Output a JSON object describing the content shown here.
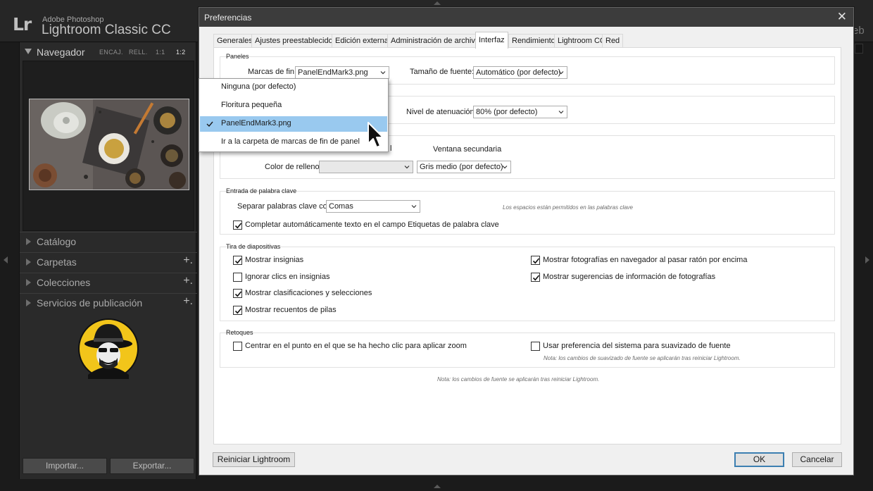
{
  "app": {
    "brand_small": "Adobe Photoshop",
    "brand_big": "Lightroom Classic CC",
    "logo": "Lr",
    "right_fragment": "eb"
  },
  "navigator": {
    "title": "Navegador",
    "zoom_options": [
      "ENCAJ.",
      "RELL.",
      "1:1",
      "1:2"
    ],
    "active_zoom": "1:2"
  },
  "panels": [
    {
      "label": "Catálogo",
      "plus": ""
    },
    {
      "label": "Carpetas",
      "plus": "+."
    },
    {
      "label": "Colecciones",
      "plus": "+."
    },
    {
      "label": "Servicios de publicación",
      "plus": "+."
    }
  ],
  "bottom_buttons": {
    "import": "Importar...",
    "export": "Exportar..."
  },
  "dialog": {
    "title": "Preferencias",
    "close": "✕",
    "tabs": [
      "Generales",
      "Ajustes preestablecidos",
      "Edición externa",
      "Administración de archivos",
      "Interfaz",
      "Rendimiento",
      "Lightroom CC",
      "Red"
    ],
    "active_tab": "Interfaz",
    "paneles": {
      "group_label": "Paneles",
      "end_marks_label": "Marcas de fin:",
      "end_marks_value": "PanelEndMark3.png",
      "font_size_label": "Tamaño de fuente:",
      "font_size_value": "Automático (por defecto)"
    },
    "lights_out": {
      "dim_level_label": "Nivel de atenuación:",
      "dim_level_value": "80% (por defecto)"
    },
    "background": {
      "fragment": "l",
      "secondary_window_label": "Ventana secundaria",
      "fill_color_label": "Color de relleno:",
      "fill_main_value": "",
      "fill_secondary_value": "Gris medio (por defecto)"
    },
    "keyword_entry": {
      "group_label": "Entrada de palabra clave",
      "separator_label": "Separar palabras clave con:",
      "separator_value": "Comas",
      "separator_note": "Los espacios están permitidos en las palabras clave",
      "autocomplete_label": "Completar automáticamente texto en el campo Etiquetas de palabra clave",
      "autocomplete_checked": true
    },
    "filmstrip": {
      "group_label": "Tira de diapositivas",
      "left": [
        {
          "label": "Mostrar insignias",
          "checked": true
        },
        {
          "label": "Ignorar clics en insignias",
          "checked": false
        },
        {
          "label": "Mostrar clasificaciones y selecciones",
          "checked": true
        },
        {
          "label": "Mostrar recuentos de pilas",
          "checked": true
        }
      ],
      "right": [
        {
          "label": "Mostrar fotografías en navegador al pasar ratón por encima",
          "checked": true
        },
        {
          "label": "Mostrar sugerencias de información de fotografías",
          "checked": true
        }
      ]
    },
    "tweaks": {
      "group_label": "Retoques",
      "zoom_click_label": "Centrar en el punto en el que se ha hecho clic para aplicar zoom",
      "zoom_click_checked": false,
      "system_font_label": "Usar preferencia del sistema para suavizado de fuente",
      "system_font_checked": false,
      "system_font_note": "Nota: los cambios de suavizado de fuente se aplicarán tras reiniciar Lightroom."
    },
    "bottom_note": "Nota: los cambios de fuente se aplicarán tras reiniciar Lightroom.",
    "buttons": {
      "restart": "Reiniciar Lightroom",
      "ok": "OK",
      "cancel": "Cancelar"
    }
  },
  "dropdown_menu": {
    "items": [
      {
        "label": "Ninguna (por defecto)",
        "selected": false
      },
      {
        "label": "Floritura pequeña",
        "selected": false
      },
      {
        "label": "PanelEndMark3.png",
        "selected": true
      },
      {
        "label": "Ir a la carpeta de marcas de fin de panel",
        "selected": false
      }
    ]
  },
  "colors": {
    "selection": "#99c9ef",
    "ok_border": "#3c7fb1",
    "lr_bg": "#1b1b1b"
  },
  "icons": [
    "chevron-down-icon",
    "checkmark-icon",
    "close-icon",
    "mouse-cursor-icon",
    "plus-icon",
    "disclosure-triangle-icon"
  ]
}
